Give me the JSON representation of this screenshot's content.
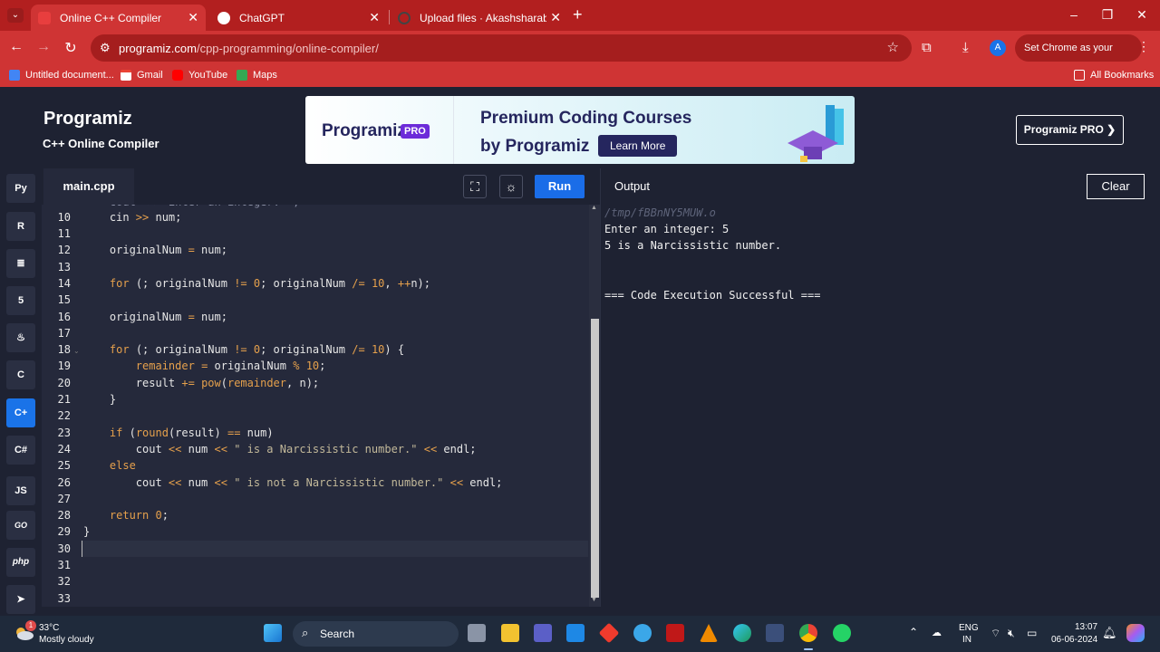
{
  "browser": {
    "tabs": [
      {
        "title": "Online C++ Compiler",
        "active": true
      },
      {
        "title": "ChatGPT",
        "active": false
      },
      {
        "title": "Upload files · Akashsharabu/DS",
        "active": false
      }
    ],
    "url_host": "programiz.com",
    "url_path": "/cpp-programming/online-compiler/",
    "set_default_label": "Set Chrome as your default",
    "avatar_letter": "A",
    "bookmarks": [
      "Untitled document...",
      "Gmail",
      "YouTube",
      "Maps"
    ],
    "all_bookmarks_label": "All Bookmarks"
  },
  "header": {
    "logo": "Programiz",
    "subtitle": "C++ Online Compiler",
    "banner": {
      "logo": "Programiz",
      "pro_badge": "PRO",
      "line1": "Premium Coding Courses",
      "line2": "by Programiz",
      "cta": "Learn More"
    },
    "pro_button": "Programiz PRO ❯"
  },
  "sidebar": {
    "languages": [
      {
        "name": "python",
        "label": "Py"
      },
      {
        "name": "r",
        "label": "R"
      },
      {
        "name": "sql",
        "label": "≣"
      },
      {
        "name": "html",
        "label": "5"
      },
      {
        "name": "java",
        "label": "♨"
      },
      {
        "name": "c",
        "label": "C"
      },
      {
        "name": "cpp",
        "label": "C+",
        "active": true
      },
      {
        "name": "csharp",
        "label": "C#"
      },
      {
        "name": "js",
        "label": "JS"
      },
      {
        "name": "go",
        "label": "GO"
      },
      {
        "name": "php",
        "label": "php"
      },
      {
        "name": "swift",
        "label": "➤"
      }
    ]
  },
  "editor": {
    "file_name": "main.cpp",
    "run_label": "Run",
    "line_numbers": [
      "10",
      "11",
      "12",
      "13",
      "14",
      "15",
      "16",
      "17",
      "18",
      "19",
      "20",
      "21",
      "22",
      "23",
      "24",
      "25",
      "26",
      "27",
      "28",
      "29",
      "30",
      "31",
      "32",
      "33"
    ]
  },
  "output": {
    "title": "Output",
    "clear_label": "Clear",
    "lines": [
      "/tmp/fBBnNY5MUW.o",
      "Enter an integer: 5",
      "5 is a Narcissistic number.",
      "",
      "",
      "=== Code Execution Successful ==="
    ]
  },
  "taskbar": {
    "weather_temp": "33°C",
    "weather_desc": "Mostly cloudy",
    "weather_badge": "1",
    "search_label": "Search",
    "lang_line1": "ENG",
    "lang_line2": "IN",
    "time": "13:07",
    "date": "06-06-2024"
  }
}
